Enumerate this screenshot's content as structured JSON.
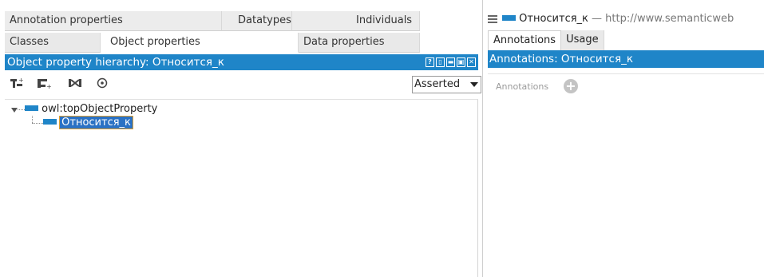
{
  "tabs_row1": [
    "Annotation properties",
    "Datatypes",
    "Individuals"
  ],
  "tabs_row2": [
    "Classes",
    "Object properties",
    "Data properties"
  ],
  "hierarchy": {
    "title": "Object property hierarchy: Относится_к",
    "window_buttons": [
      "?",
      "▯",
      "▬",
      "▣",
      "✕"
    ],
    "toolbar_icons": [
      "add-sub-property-icon",
      "add-sibling-property-icon",
      "delete-property-icon",
      "refresh-icon"
    ],
    "mode": "Asserted",
    "root": "owl:topObjectProperty",
    "child": "Относится_к"
  },
  "right": {
    "entity_name": "Относится_к",
    "entity_iri": " — http://www.semanticweb",
    "tabs": [
      "Annotations",
      "Usage"
    ],
    "header": "Annotations: Относится_к",
    "annotations_label": "Annotations",
    "add_symbol": "+"
  },
  "colors": {
    "accent": "#1f85c8",
    "selection": "#2b72c4"
  }
}
